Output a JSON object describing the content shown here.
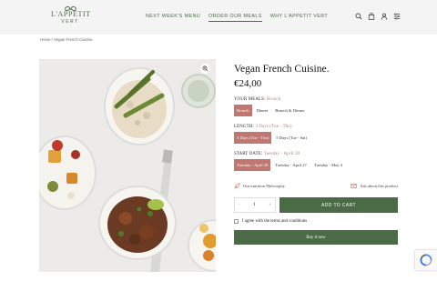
{
  "brand": {
    "line1": "L'APPETIT",
    "line2": "VERT"
  },
  "nav": {
    "items": [
      {
        "label": "NEXT WEEK'S MENU"
      },
      {
        "label": "ORDER OUR MEALS"
      },
      {
        "label": "WHY L'APPETIT VERT"
      }
    ]
  },
  "header_icons": [
    "search-icon",
    "bag-icon",
    "user-icon",
    "settings-icon"
  ],
  "breadcrumb": {
    "home": "Home",
    "sep": "/",
    "current": "Vegan French Cuisine."
  },
  "product": {
    "title": "Vegan French Cuisine.",
    "price": "€24,00"
  },
  "options": {
    "meals": {
      "label": "YOUR MEALS:",
      "selected": "Brunch",
      "choices": [
        "Brunch",
        "Dinner",
        "Brunch & Dinner"
      ]
    },
    "length": {
      "label": "LENGTH:",
      "selected": "3 Days (Tue - Thu)",
      "choices": [
        "3 Days (Tue - Thu)",
        "5 Days (Tue - Sat)"
      ]
    },
    "start": {
      "label": "START DATE:",
      "selected": "Tuesday - April 20",
      "choices": [
        "Tuesday - April 20",
        "Tuesday - April 27",
        "Tuesday - May 4"
      ]
    }
  },
  "links": {
    "nutrition": "Our nutrition Philosophy",
    "ask": "Ask about this product"
  },
  "cart": {
    "minus": "-",
    "quantity": "1",
    "plus": "+",
    "add_label": "ADD TO CART"
  },
  "terms": {
    "label": "I agree with the terms and conditions"
  },
  "buy": {
    "label": "Buy it now"
  },
  "colors": {
    "accent_green": "#4a6b45",
    "accent_rose": "#c0776f",
    "header_bg": "#f4f4f4"
  }
}
